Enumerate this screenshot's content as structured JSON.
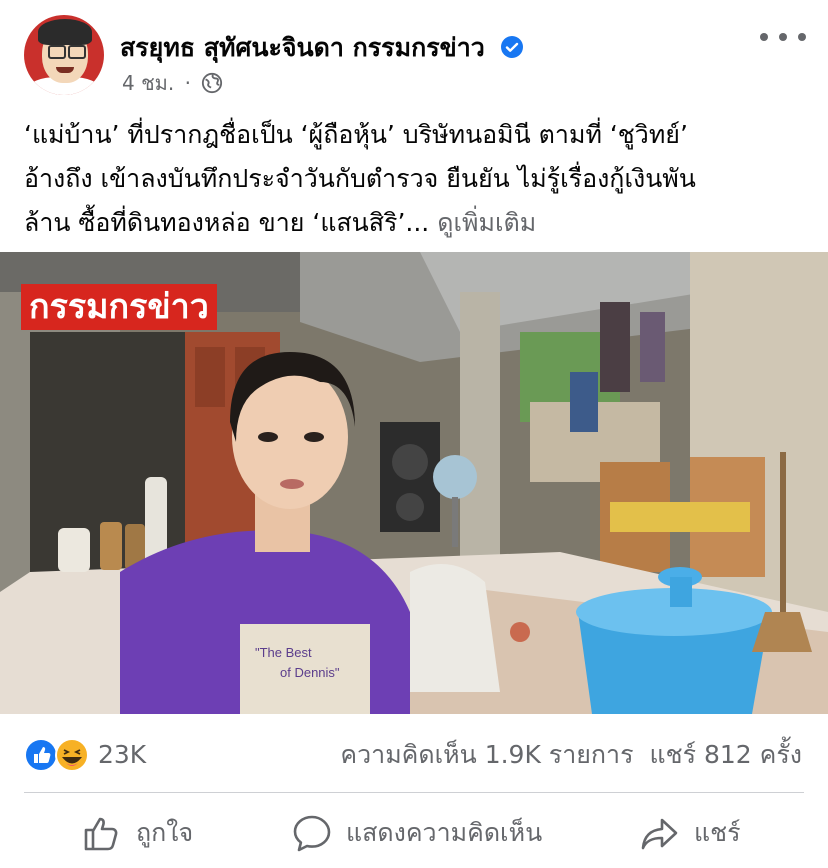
{
  "post": {
    "author": "สรยุทธ สุทัศนะจินดา กรรมกรข่าว",
    "time": "4 ชม.",
    "separator": "·",
    "caption_lines": [
      "‘แม่บ้าน’ ที่ปรากฎชื่อเป็น ‘ผู้ถือหุ้น’ บริษัทนอมินี ตามที่ ‘ชูวิทย์’",
      "อ้างถึง เข้าลงบันทึกประจำวันกับตำรวจ ยืนยัน ไม่รู้เรื่องกู้เงินพัน",
      "ล้าน ซื้อที่ดินทองหล่อ ขาย ‘แสนสิริ’..."
    ],
    "see_more": "ดูเพิ่มเติม",
    "image_overlay_text": "กรรมกรข่าว",
    "shirt_text_line1": "\"The Best",
    "shirt_text_line2": "of Dennis\""
  },
  "stats": {
    "reactions_count": "23K",
    "reaction_icons": [
      "like-icon",
      "haha-icon"
    ],
    "comments": "ความคิดเห็น 1.9K รายการ",
    "shares": "แชร์ 812 ครั้ง"
  },
  "actions": {
    "like": "ถูกใจ",
    "comment": "แสดงความคิดเห็น",
    "share": "แชร์"
  },
  "colors": {
    "verified": "#1877f2",
    "like_blue": "#1877f2",
    "haha_yellow": "#f7b125",
    "overlay_red": "#d7261e",
    "secondary_text": "#65676b"
  }
}
